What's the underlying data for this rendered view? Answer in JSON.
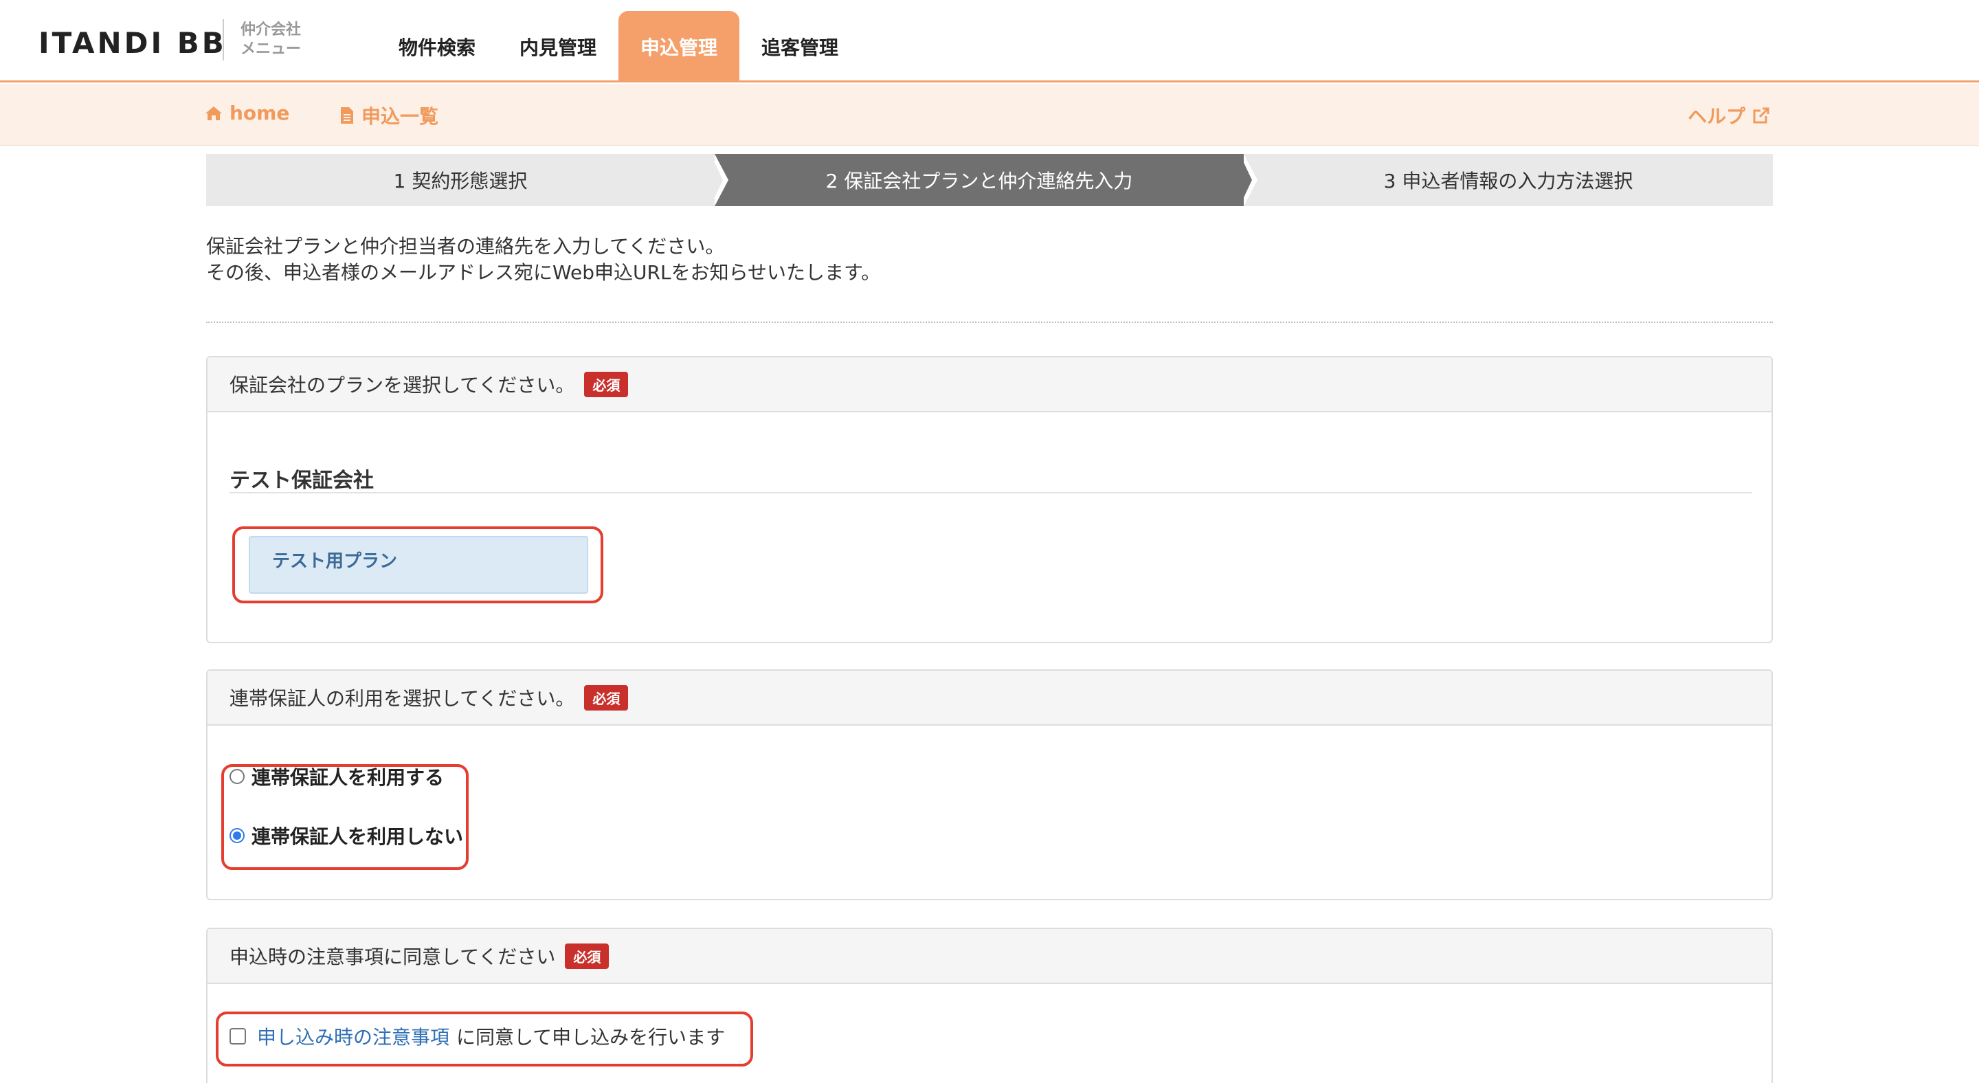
{
  "header": {
    "logo": "ITANDI BB",
    "menu_line1": "仲介会社",
    "menu_line2": "メニュー",
    "tabs": [
      {
        "label": "物件検索",
        "active": false
      },
      {
        "label": "内見管理",
        "active": false
      },
      {
        "label": "申込管理",
        "active": true
      },
      {
        "label": "追客管理",
        "active": false
      }
    ]
  },
  "subbar": {
    "home": "home",
    "list": "申込一覧",
    "help": "ヘルプ"
  },
  "steps": [
    {
      "label": "1 契約形態選択"
    },
    {
      "label": "2 保証会社プランと仲介連絡先入力"
    },
    {
      "label": "3 申込者情報の入力方法選択"
    }
  ],
  "intro": {
    "line1": "保証会社プランと仲介担当者の連絡先を入力してください。",
    "line2": "その後、申込者様のメールアドレス宛にWeb申込URLをお知らせいたします。"
  },
  "plan_section": {
    "title": "保証会社のプランを選択してください。",
    "badge": "必須",
    "company": "テスト保証会社",
    "plan_button": "テスト用プラン"
  },
  "guarantor_section": {
    "title": "連帯保証人の利用を選択してください。",
    "badge": "必須",
    "options": [
      {
        "label": "連帯保証人を利用する",
        "checked": false
      },
      {
        "label": "連帯保証人を利用しない",
        "checked": true
      }
    ]
  },
  "terms_section": {
    "title": "申込時の注意事項に同意してください",
    "badge": "必須",
    "link_text": "申し込み時の注意事項",
    "agree_text": "に同意して申し込みを行います",
    "checked": false
  },
  "colors": {
    "accent": "#f5a06a",
    "subbar_bg": "#fdf0e6",
    "active_step": "#707070",
    "required_badge": "#c9302c",
    "highlight_frame": "#e53d2f",
    "link": "#2f6fb5"
  }
}
